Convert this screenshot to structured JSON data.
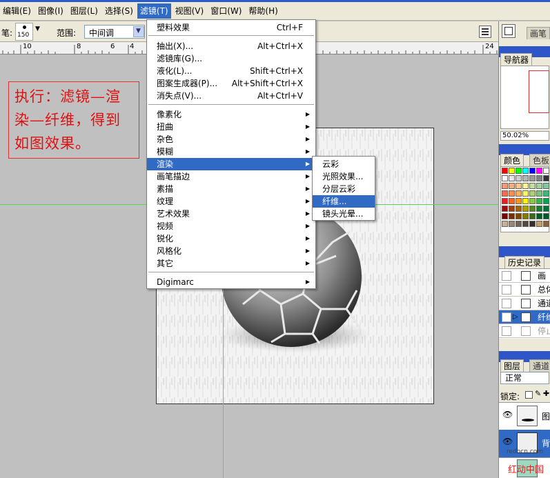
{
  "menubar": {
    "items": [
      {
        "label": "编辑(E)"
      },
      {
        "label": "图像(I)"
      },
      {
        "label": "图层(L)"
      },
      {
        "label": "选择(S)"
      },
      {
        "label": "滤镜(T)"
      },
      {
        "label": "视图(V)"
      },
      {
        "label": "窗口(W)"
      },
      {
        "label": "帮助(H)"
      }
    ]
  },
  "options_bar": {
    "brush_label": "笔:",
    "brush_size": "150",
    "range_label": "范围:",
    "range_value": "中间调"
  },
  "ruler": {
    "ticks": [
      "10",
      "8",
      "6",
      "4",
      "24"
    ]
  },
  "note": {
    "line1": "执行：滤镜—渲",
    "line2": "染—纤维，得到",
    "line3": "如图效果。"
  },
  "filter_menu": {
    "items": [
      {
        "label": "塑料效果",
        "shortcut": "Ctrl+F"
      },
      {
        "label": "抽出(X)...",
        "shortcut": "Alt+Ctrl+X"
      },
      {
        "label": "滤镜库(G)...",
        "shortcut": ""
      },
      {
        "label": "液化(L)...",
        "shortcut": "Shift+Ctrl+X"
      },
      {
        "label": "图案生成器(P)...",
        "shortcut": "Alt+Shift+Ctrl+X"
      },
      {
        "label": "消失点(V)...",
        "shortcut": "Alt+Ctrl+V"
      },
      {
        "label": "像素化",
        "shortcut": ""
      },
      {
        "label": "扭曲",
        "shortcut": ""
      },
      {
        "label": "杂色",
        "shortcut": ""
      },
      {
        "label": "模糊",
        "shortcut": ""
      },
      {
        "label": "渲染",
        "shortcut": ""
      },
      {
        "label": "画笔描边",
        "shortcut": ""
      },
      {
        "label": "素描",
        "shortcut": ""
      },
      {
        "label": "纹理",
        "shortcut": ""
      },
      {
        "label": "艺术效果",
        "shortcut": ""
      },
      {
        "label": "视频",
        "shortcut": ""
      },
      {
        "label": "锐化",
        "shortcut": ""
      },
      {
        "label": "风格化",
        "shortcut": ""
      },
      {
        "label": "其它",
        "shortcut": ""
      },
      {
        "label": "Digimarc",
        "shortcut": ""
      }
    ]
  },
  "render_submenu": {
    "items": [
      {
        "label": "云彩"
      },
      {
        "label": "光照效果..."
      },
      {
        "label": "分层云彩"
      },
      {
        "label": "纤维..."
      },
      {
        "label": "镜头光晕..."
      }
    ]
  },
  "right_panel": {
    "top_tab": "画笔",
    "navigator_tab": "导航器",
    "zoom": "50.02%",
    "color_tab": "颜色",
    "swatches_tab": "色板",
    "history_tab": "历史记录",
    "history_items": [
      {
        "label": "画"
      },
      {
        "label": "总体"
      },
      {
        "label": "通道"
      },
      {
        "label": "纤维"
      },
      {
        "label": "停止"
      }
    ],
    "layers_tab": "图层",
    "channels_tab": "通道",
    "blend_mode": "正常",
    "lock_label": "锁定:",
    "layers": [
      {
        "label": "图"
      },
      {
        "label": "背"
      }
    ]
  },
  "watermark": {
    "site": "redocn.com",
    "name": "红动中国"
  },
  "colors": {
    "menu_highlight": "#316ac5",
    "note_red": "#e01010",
    "guide_green": "#5bd35b",
    "panel_bg": "#ece9d8"
  }
}
